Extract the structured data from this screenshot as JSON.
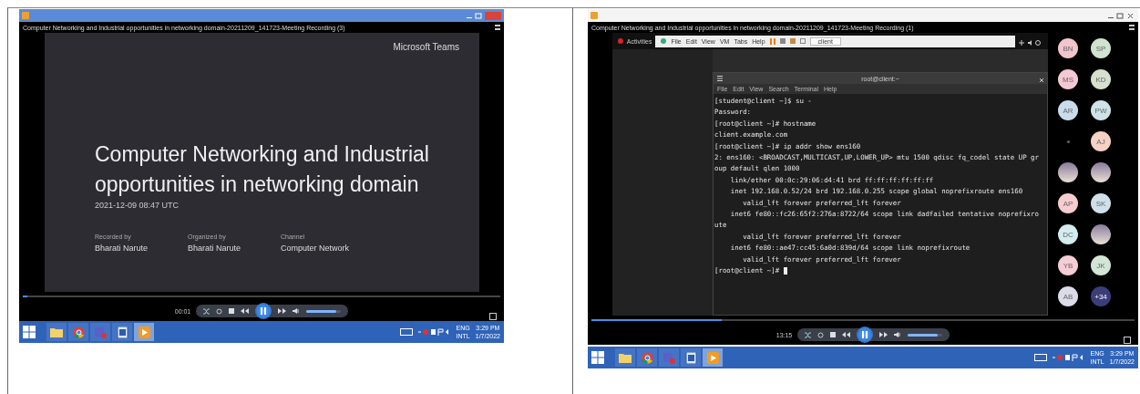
{
  "screenshots": [
    {
      "kind": "slide",
      "title_bar": {
        "active": true
      },
      "caption": "Computer Networking and Industrial opportunities in networking domain-20211209_141723-Meeting Recording (3)",
      "slide": {
        "brand": "Microsoft Teams",
        "title": "Computer Networking and Industrial opportunities in networking domain",
        "date": "2021-12-09 08:47 UTC",
        "meta": [
          {
            "label": "Recorded by",
            "value": "Bharati Narute"
          },
          {
            "label": "Organized by",
            "value": "Bharati Narute"
          },
          {
            "label": "Channel",
            "value": "Computer Network"
          }
        ]
      },
      "player": {
        "time": "00:01",
        "seek": {
          "level": 0.01
        },
        "volume": {
          "level": 0.85
        }
      },
      "taskbar": {
        "apps": [
          {
            "kind": "folder",
            "selected": false
          },
          {
            "kind": "browser",
            "selected": false
          },
          {
            "kind": "chat",
            "selected": false
          },
          {
            "kind": "mail",
            "selected": false
          },
          {
            "kind": "player",
            "selected": true
          }
        ],
        "language": [
          "ENG",
          "INTL"
        ],
        "clock": [
          "3:29 PM",
          "1/7/2022"
        ]
      }
    },
    {
      "kind": "terminal",
      "title_bar": {
        "active": false
      },
      "caption": "Computer Networking and Industrial opportunities in networking domain-20211209_141723-Meeting Recording (1)",
      "vm": {
        "activities": "Activities",
        "menu": [
          "File",
          "Edit",
          "View",
          "VM",
          "Tabs",
          "Help"
        ],
        "tabs": [
          {
            "label": "client",
            "selected": true
          }
        ],
        "terminal": {
          "title": "root@client:~",
          "menu": [
            "File",
            "Edit",
            "View",
            "Search",
            "Terminal",
            "Help"
          ],
          "lines": [
            "[student@client ~]$ su -",
            "Password:",
            "[root@client ~]# hostname",
            "client.example.com",
            "[root@client ~]# ip addr show ens160",
            "2: ens160: <BROADCAST,MULTICAST,UP,LOWER_UP> mtu 1500 qdisc fq_codel state UP gr",
            "oup default qlen 1000",
            "    link/ether 00:0c:29:06:d4:41 brd ff:ff:ff:ff:ff:ff",
            "    inet 192.168.0.52/24 brd 192.168.0.255 scope global noprefixroute ens160",
            "       valid_lft forever preferred_lft forever",
            "    inet6 fe80::fc26:65f2:276a:8722/64 scope link dadfailed tentative noprefixro",
            "ute",
            "       valid_lft forever preferred_lft forever",
            "    inet6 fe80::ae47:cc45:6a0d:839d/64 scope link noprefixroute",
            "       valid_lft forever preferred_lft forever",
            "[root@client ~]# "
          ]
        }
      },
      "participants": [
        {
          "kind": "initials",
          "initials": "BN",
          "color": "#f2c4cc"
        },
        {
          "kind": "initials",
          "initials": "SP",
          "color": "#cfe3cf"
        },
        {
          "kind": "initials",
          "initials": "MS",
          "color": "#f4c8d4"
        },
        {
          "kind": "initials",
          "initials": "KD",
          "color": "#d7dfcf"
        },
        {
          "kind": "initials",
          "initials": "AR",
          "color": "#c9dcec"
        },
        {
          "kind": "initials",
          "initials": "PW",
          "color": "#cde3e8"
        },
        {
          "kind": "blank"
        },
        {
          "kind": "initials",
          "initials": "AJ",
          "color": "#f6d2c4"
        },
        {
          "kind": "photo"
        },
        {
          "kind": "photo"
        },
        {
          "kind": "initials",
          "initials": "AP",
          "color": "#f6ccd0"
        },
        {
          "kind": "initials",
          "initials": "SK",
          "color": "#cfe0ea"
        },
        {
          "kind": "initials",
          "initials": "DC",
          "color": "#d2ecef"
        },
        {
          "kind": "photo"
        },
        {
          "kind": "initials",
          "initials": "YB",
          "color": "#f6ccd6"
        },
        {
          "kind": "initials",
          "initials": "JK",
          "color": "#d2e6d6"
        },
        {
          "kind": "initials",
          "initials": "AB",
          "color": "#dcdbe8"
        },
        {
          "kind": "initials",
          "initials": "+34",
          "color": "#3b3d7a"
        }
      ],
      "player": {
        "time": "13:15",
        "seek": {
          "level": 0.24
        },
        "volume": {
          "level": 0.85
        }
      },
      "taskbar": {
        "apps": [
          {
            "kind": "folder",
            "selected": false
          },
          {
            "kind": "browser",
            "selected": false
          },
          {
            "kind": "chat",
            "selected": false
          },
          {
            "kind": "mail",
            "selected": false
          },
          {
            "kind": "player",
            "selected": true
          }
        ],
        "language": [
          "ENG",
          "INTL"
        ],
        "clock": [
          "3:29 PM",
          "1/7/2022"
        ]
      }
    }
  ]
}
